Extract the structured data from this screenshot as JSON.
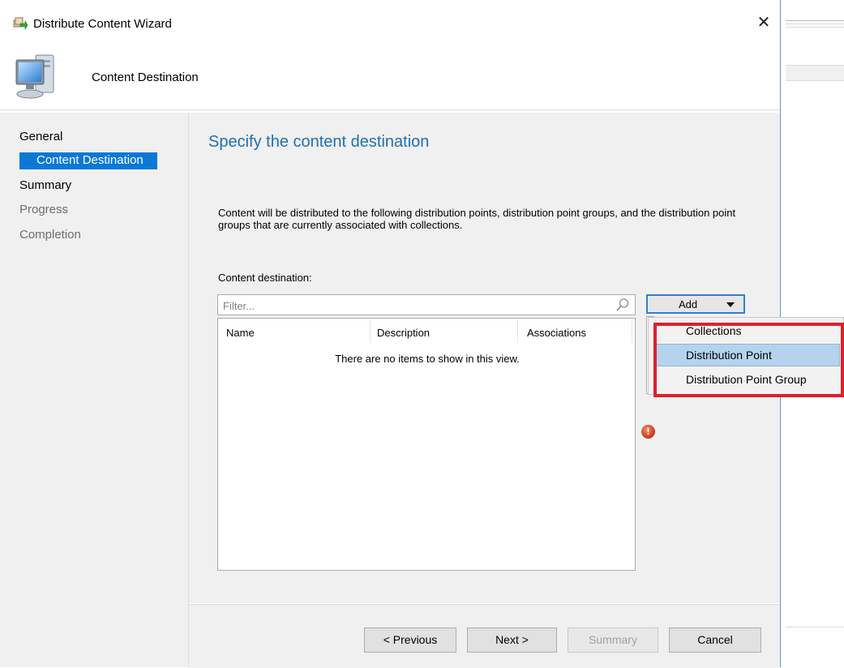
{
  "window": {
    "title": "Distribute Content Wizard",
    "close_glyph": "✕",
    "header_title": "Content Destination"
  },
  "nav": {
    "general": "General",
    "content_destination": "Content Destination",
    "summary": "Summary",
    "progress": "Progress",
    "completion": "Completion"
  },
  "main": {
    "heading": "Specify the content destination",
    "description": "Content will be distributed to the following distribution points, distribution point groups, and the distribution point groups that are currently associated with collections.",
    "content_destination_label": "Content destination:",
    "filter_placeholder": "Filter...",
    "columns": [
      "Name",
      "Description",
      "Associations"
    ],
    "empty_message": "There are no items to show in this view.",
    "add_label": "Add",
    "error_glyph": "!"
  },
  "add_menu": {
    "items": [
      "Collections",
      "Distribution Point",
      "Distribution Point Group"
    ],
    "highlighted": "Distribution Point"
  },
  "footer": {
    "previous": "< Previous",
    "next": "Next >",
    "summary": "Summary",
    "cancel": "Cancel"
  },
  "colors": {
    "accent": "#0a78d7",
    "heading": "#1f6fb4",
    "highlight_box": "#e0202a",
    "menu_highlight": "#b6d3ee"
  }
}
